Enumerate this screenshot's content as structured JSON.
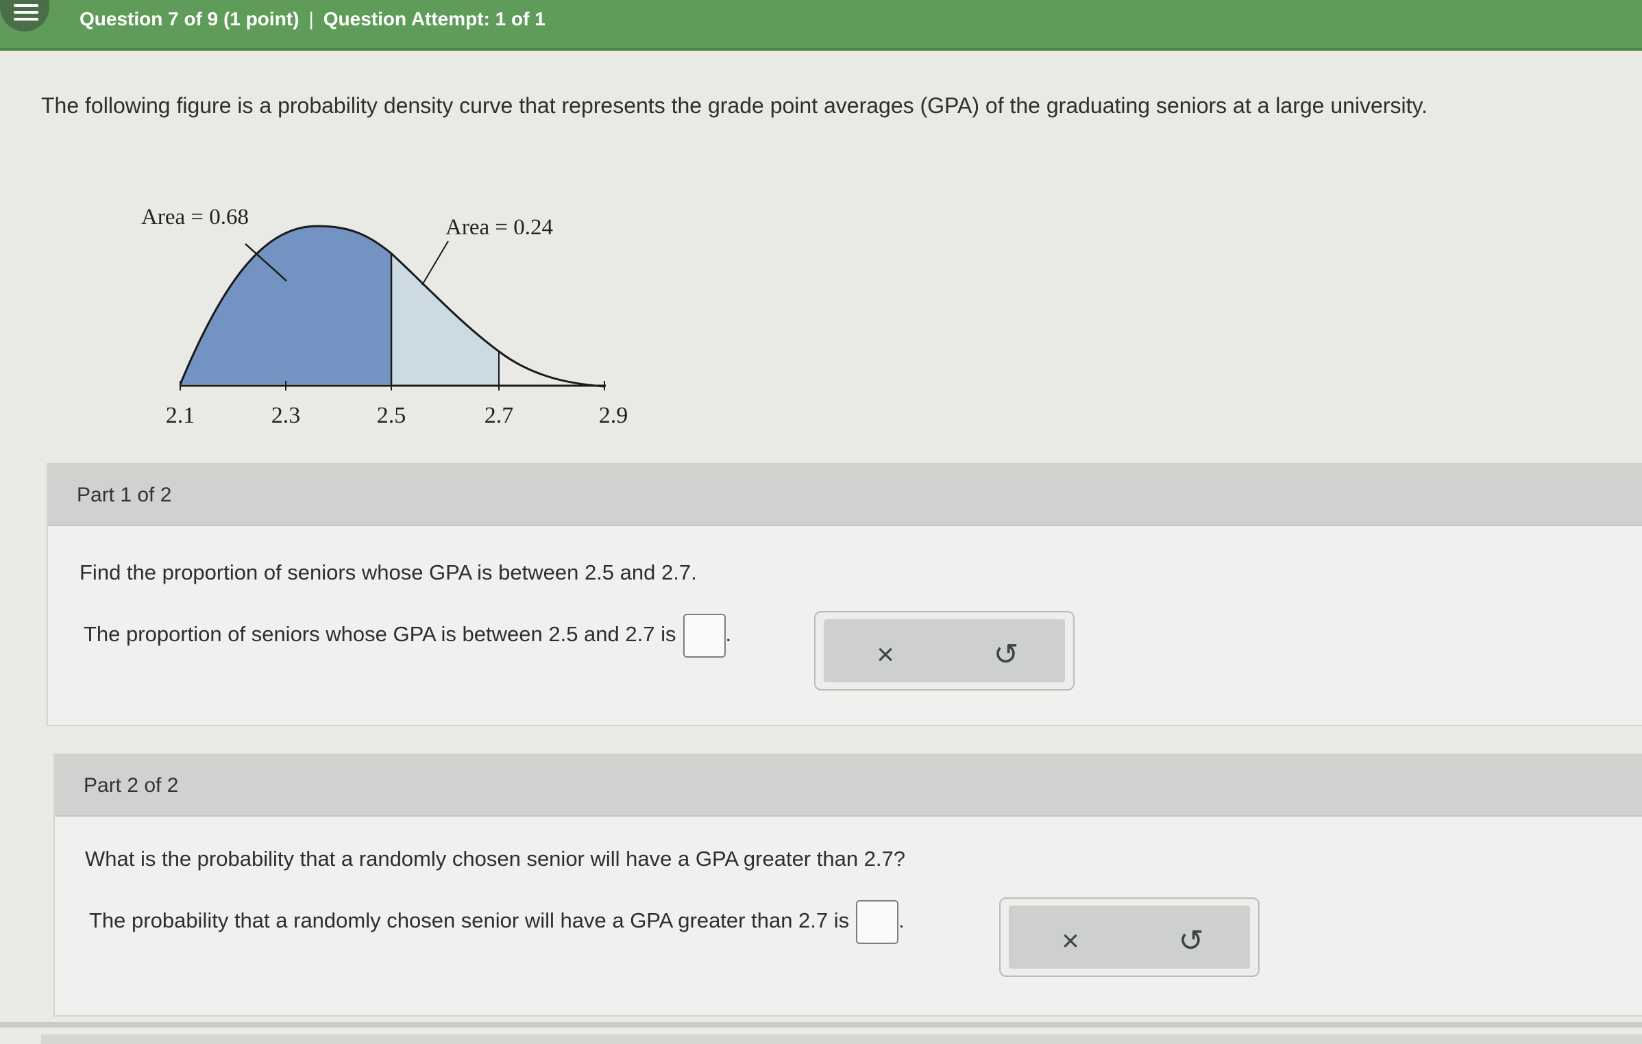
{
  "header": {
    "question_progress": "Question 7 of 9 (1 point)",
    "separator": "|",
    "attempt": "Question Attempt: 1 of 1"
  },
  "intro_text": "The following figure is a probability density curve that represents the grade point averages (GPA) of the graduating seniors at a large university.",
  "figure": {
    "area_label_left": "Area = 0.68",
    "area_label_right": "Area = 0.24",
    "ticks": [
      "2.1",
      "2.3",
      "2.5",
      "2.7",
      "2.9"
    ],
    "colors": {
      "dark_region": "#7393c2",
      "light_region": "#ccdbe1",
      "curve": "#1a1a1a"
    }
  },
  "part1": {
    "label": "Part 1 of 2",
    "question": "Find the proportion of seniors whose GPA is between 2.5 and 2.7.",
    "answer_prompt": "The proportion of seniors whose GPA is between 2.5 and 2.7 is",
    "answer_value": "",
    "suffix": "."
  },
  "part2": {
    "label": "Part 2 of 2",
    "question": "What is the probability that a randomly chosen senior will have a GPA greater than 2.7?",
    "answer_prompt": "The probability that a randomly chosen senior will have a GPA greater than 2.7 is",
    "answer_value": "",
    "suffix": "."
  },
  "buttons": {
    "clear_icon": "×",
    "reset_icon": "↺"
  },
  "colors": {
    "topbar": "#5f9c5a",
    "menu": "#4a6e48",
    "part_header": "#cfd2cf"
  }
}
